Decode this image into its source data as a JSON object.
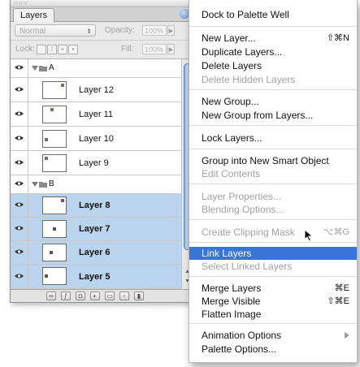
{
  "palette": {
    "tab_label": "Layers",
    "blend_mode": "Normal",
    "opacity_label": "Opacity:",
    "opacity_value": "100%",
    "lock_label": "Lock:",
    "fill_label": "Fill:",
    "fill_value": "100%",
    "groups": [
      {
        "name": "A",
        "layers": [
          {
            "name": "Layer 12",
            "selected": false
          },
          {
            "name": "Layer 11",
            "selected": false
          },
          {
            "name": "Layer 10",
            "selected": false
          },
          {
            "name": "Layer 9",
            "selected": false
          }
        ]
      },
      {
        "name": "B",
        "layers": [
          {
            "name": "Layer 8",
            "selected": true
          },
          {
            "name": "Layer 7",
            "selected": true
          },
          {
            "name": "Layer 6",
            "selected": true
          },
          {
            "name": "Layer 5",
            "selected": true
          }
        ]
      }
    ],
    "selection_color": "#b9d4ec"
  },
  "menu": {
    "highlight_color": "#3875d7",
    "items": [
      {
        "label": "Dock to Palette Well",
        "shortcut": "",
        "disabled": false
      },
      {
        "label": "New Layer...",
        "shortcut": "⇧⌘N",
        "disabled": false
      },
      {
        "label": "Duplicate Layers...",
        "shortcut": "",
        "disabled": false
      },
      {
        "label": "Delete Layers",
        "shortcut": "",
        "disabled": false
      },
      {
        "label": "Delete Hidden Layers",
        "shortcut": "",
        "disabled": true
      },
      {
        "label": "New Group...",
        "shortcut": "",
        "disabled": false
      },
      {
        "label": "New Group from Layers...",
        "shortcut": "",
        "disabled": false
      },
      {
        "label": "Lock Layers...",
        "shortcut": "",
        "disabled": false
      },
      {
        "label": "Group into New Smart Object",
        "shortcut": "",
        "disabled": false
      },
      {
        "label": "Edit Contents",
        "shortcut": "",
        "disabled": true
      },
      {
        "label": "Layer Properties...",
        "shortcut": "",
        "disabled": true
      },
      {
        "label": "Blending Options...",
        "shortcut": "",
        "disabled": true
      },
      {
        "label": "Create Clipping Mask",
        "shortcut": "⌥⌘G",
        "disabled": true
      },
      {
        "label": "Link Layers",
        "shortcut": "",
        "disabled": false,
        "highlighted": true
      },
      {
        "label": "Select Linked Layers",
        "shortcut": "",
        "disabled": true
      },
      {
        "label": "Merge Layers",
        "shortcut": "⌘E",
        "disabled": false
      },
      {
        "label": "Merge Visible",
        "shortcut": "⇧⌘E",
        "disabled": false
      },
      {
        "label": "Flatten Image",
        "shortcut": "",
        "disabled": false
      },
      {
        "label": "Animation Options",
        "shortcut": "",
        "disabled": false,
        "submenu": true
      },
      {
        "label": "Palette Options...",
        "shortcut": "",
        "disabled": false
      }
    ]
  }
}
